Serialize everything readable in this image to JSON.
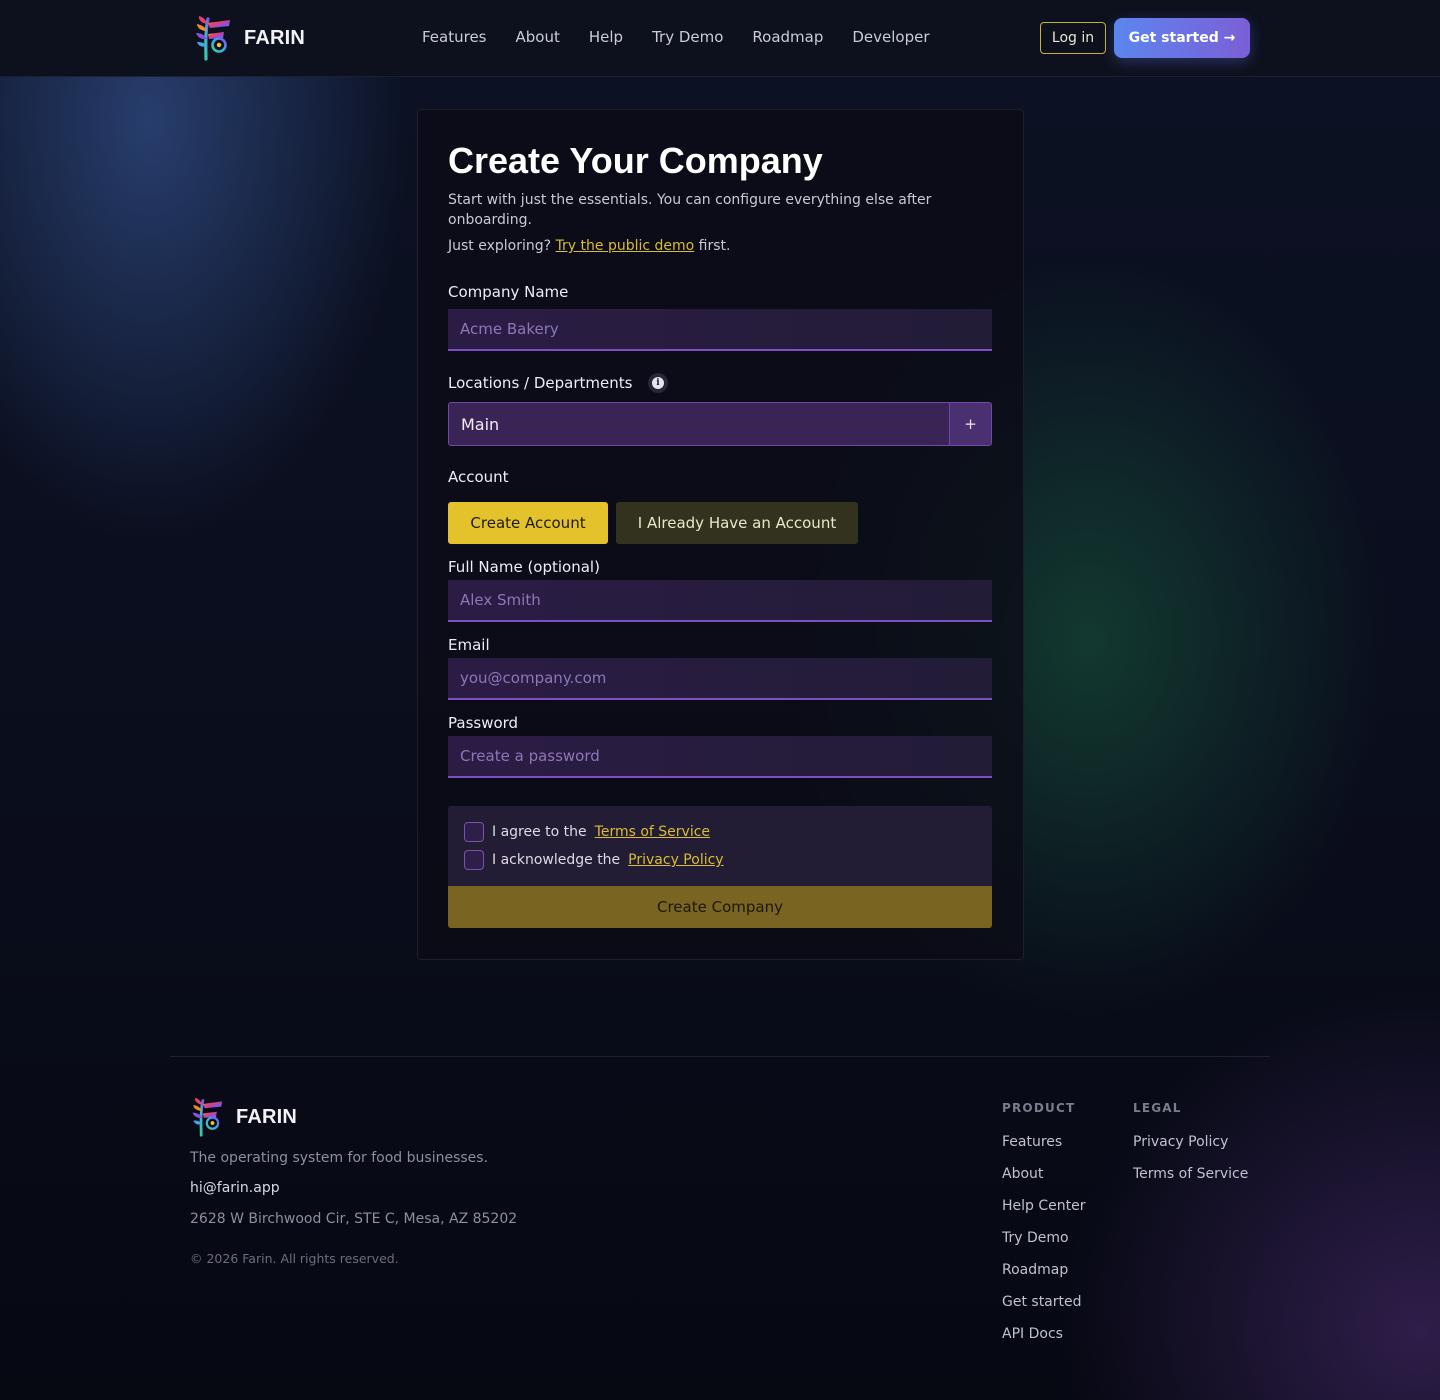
{
  "nav": {
    "brand": "FARIN",
    "links": [
      "Features",
      "About",
      "Help",
      "Try Demo",
      "Roadmap",
      "Developer"
    ],
    "login_label": "Log in",
    "get_started_label": "Get started →"
  },
  "form": {
    "title": "Create Your Company",
    "subtitle": "Start with just the essentials. You can configure everything else after onboarding.",
    "explore_prefix": "Just exploring?",
    "explore_link": "Try the public demo",
    "explore_suffix": "first.",
    "company_name": {
      "label": "Company Name",
      "placeholder": "Acme Bakery",
      "value": ""
    },
    "locations": {
      "label": "Locations / Departments",
      "value": "Main",
      "add_label": "+"
    },
    "account": {
      "label": "Account",
      "options": [
        "Create Account",
        "I Already Have an Account"
      ],
      "selected": "Create Account"
    },
    "full_name": {
      "label": "Full Name (optional)",
      "placeholder": "Alex Smith",
      "value": ""
    },
    "email": {
      "label": "Email",
      "placeholder": "you@company.com",
      "value": ""
    },
    "password": {
      "label": "Password",
      "placeholder": "Create a password",
      "value": ""
    },
    "agree_tos_prefix": "I agree to the",
    "agree_tos_link": "Terms of Service",
    "agree_privacy_prefix": "I acknowledge the",
    "agree_privacy_link": "Privacy Policy",
    "submit_label": "Create Company"
  },
  "footer": {
    "brand": "FARIN",
    "tagline": "The operating system for food businesses.",
    "email": "hi@farin.app",
    "address": "2628 W Birchwood Cir, STE C, Mesa, AZ 85202",
    "copyright": "© 2026 Farin. All rights reserved.",
    "product_heading": "PRODUCT",
    "product_links": [
      "Features",
      "About",
      "Help Center",
      "Try Demo",
      "Roadmap",
      "Get started",
      "API Docs"
    ],
    "legal_heading": "LEGAL",
    "legal_links": [
      "Privacy Policy",
      "Terms of Service"
    ]
  },
  "colors": {
    "accent_yellow": "#e3c22c",
    "accent_purple": "#7e4fc2",
    "cta_gradient_start": "#5c86ef",
    "cta_gradient_end": "#7b5fd6"
  },
  "icons": {
    "logo": "farin-logo-icon",
    "info": "info-icon",
    "add": "plus-icon"
  }
}
